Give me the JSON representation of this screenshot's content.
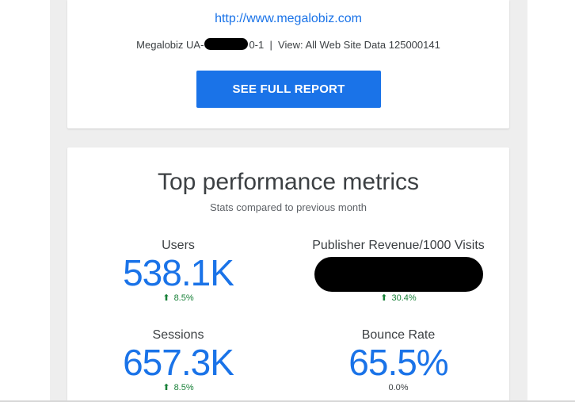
{
  "report": {
    "site_url": "http://www.megalobiz.com",
    "account_prefix": "Megalobiz UA-",
    "account_suffix": "0-1  |  View: All Web Site Data 125000141",
    "button_label": "SEE FULL REPORT"
  },
  "metrics_section": {
    "title": "Top performance metrics",
    "subtitle": "Stats compared to previous month",
    "metrics": [
      {
        "label": "Users",
        "value": "538.1K",
        "change": "8.5%",
        "trend": "up",
        "arrow": "⬆"
      },
      {
        "label": "Publisher Revenue/1000 Visits",
        "value": "",
        "redacted": true,
        "change": "30.4%",
        "trend": "up",
        "arrow": "⬆"
      },
      {
        "label": "Sessions",
        "value": "657.3K",
        "change": "8.5%",
        "trend": "up",
        "arrow": "⬆"
      },
      {
        "label": "Bounce Rate",
        "value": "65.5%",
        "change": "0.0%",
        "trend": "neutral"
      }
    ]
  },
  "colors": {
    "accent": "#1a73e8",
    "positive": "#188038",
    "background_band": "#eeeeee"
  }
}
